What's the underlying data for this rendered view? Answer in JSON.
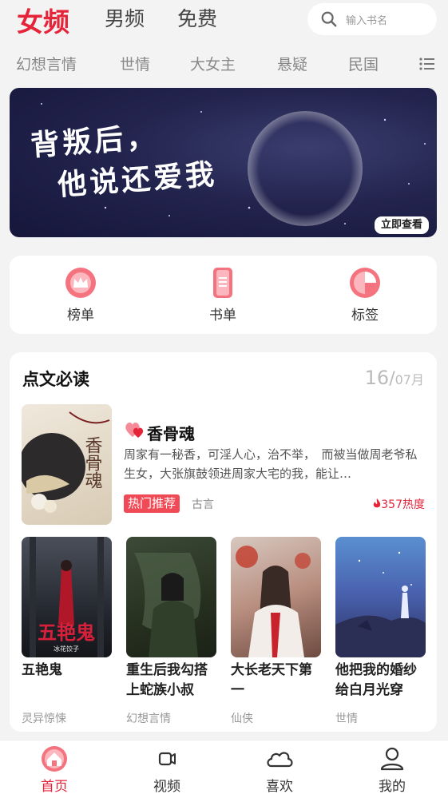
{
  "top_tabs": [
    "女频",
    "男频",
    "免费"
  ],
  "search": {
    "placeholder": "输入书名"
  },
  "categories": [
    "幻想言情",
    "世情",
    "大女主",
    "悬疑",
    "民国"
  ],
  "banner": {
    "line1": "背叛后，",
    "line2": "他说还爱我",
    "cta": "立即查看"
  },
  "quick_links": [
    "榜单",
    "书单",
    "标签"
  ],
  "section": {
    "title": "点文必读",
    "date_day": "16",
    "date_sep": "/",
    "date_month": "07月",
    "featured": {
      "title": "香骨魂",
      "desc": "周家有一秘香，可淫人心，治不举，　而被当做周老爷私生女，大张旗鼓领进周家大宅的我，能让…",
      "badge": "热门推荐",
      "genre": "古言",
      "heat": "357热度",
      "cover_text": "香骨魂"
    },
    "books": [
      {
        "title": "五艳鬼",
        "genre": "灵异惊悚",
        "cover_text": "五艳鬼",
        "cover_sub": "冰花饺子"
      },
      {
        "title": "重生后我勾搭上蛇族小叔",
        "genre": "幻想言情"
      },
      {
        "title": "大长老天下第一",
        "genre": "仙侠"
      },
      {
        "title": "他把我的婚纱给白月光穿",
        "genre": "世情"
      }
    ]
  },
  "bottom_nav": [
    "首页",
    "视频",
    "喜欢",
    "我的"
  ],
  "colors": {
    "accent": "#e5243a",
    "background": "#f3f3f3",
    "banner": "#23244e"
  },
  "icons": [
    "search-icon",
    "menu-list-icon",
    "crown-icon",
    "book-list-icon",
    "tag-pie-icon",
    "heart-icon",
    "flame-icon",
    "home-icon",
    "video-icon",
    "cloud-icon",
    "user-icon"
  ]
}
